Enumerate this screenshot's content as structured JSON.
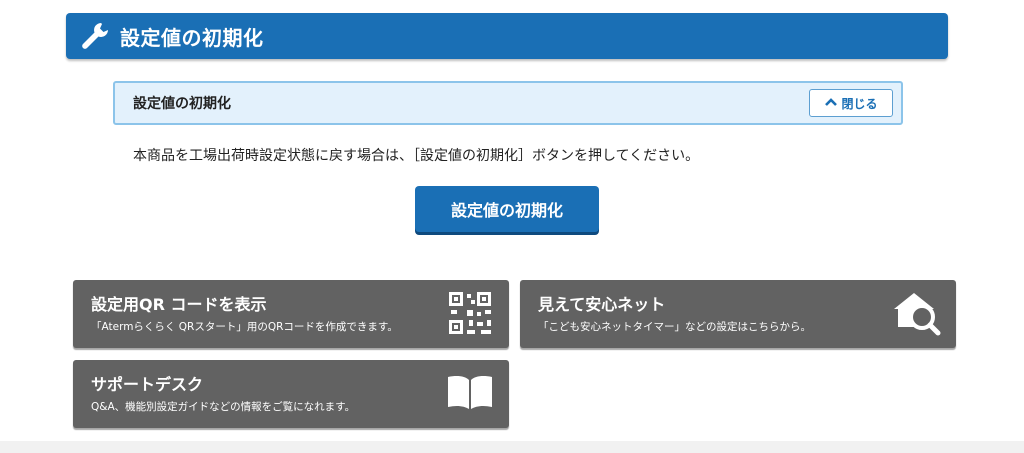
{
  "header": {
    "title": "設定値の初期化",
    "icon": "wrench-icon"
  },
  "section": {
    "label": "設定値の初期化",
    "close_label": "閉じる",
    "close_icon": "chevron-up-icon"
  },
  "description": "本商品を工場出荷時設定状態に戻す場合は、［設定値の初期化］ボタンを押してください。",
  "primary_button": {
    "label": "設定値の初期化"
  },
  "cards": [
    {
      "title": "設定用QR コードを表示",
      "subtitle": "「Atermらくらく QRスタート」用のQRコードを作成できます。",
      "icon": "qr-code-icon"
    },
    {
      "title": "見えて安心ネット",
      "subtitle": "「こども安心ネットタイマー」などの設定はこちらから。",
      "icon": "house-search-icon"
    },
    {
      "title": "サポートデスク",
      "subtitle": "Q&A、機能別設定ガイドなどの情報をご覧になれます。",
      "icon": "book-icon"
    }
  ],
  "colors": {
    "primary": "#1a6fb5",
    "card_bg": "#626262",
    "section_bg": "#e3f1fc",
    "section_border": "#8cc4ea"
  }
}
